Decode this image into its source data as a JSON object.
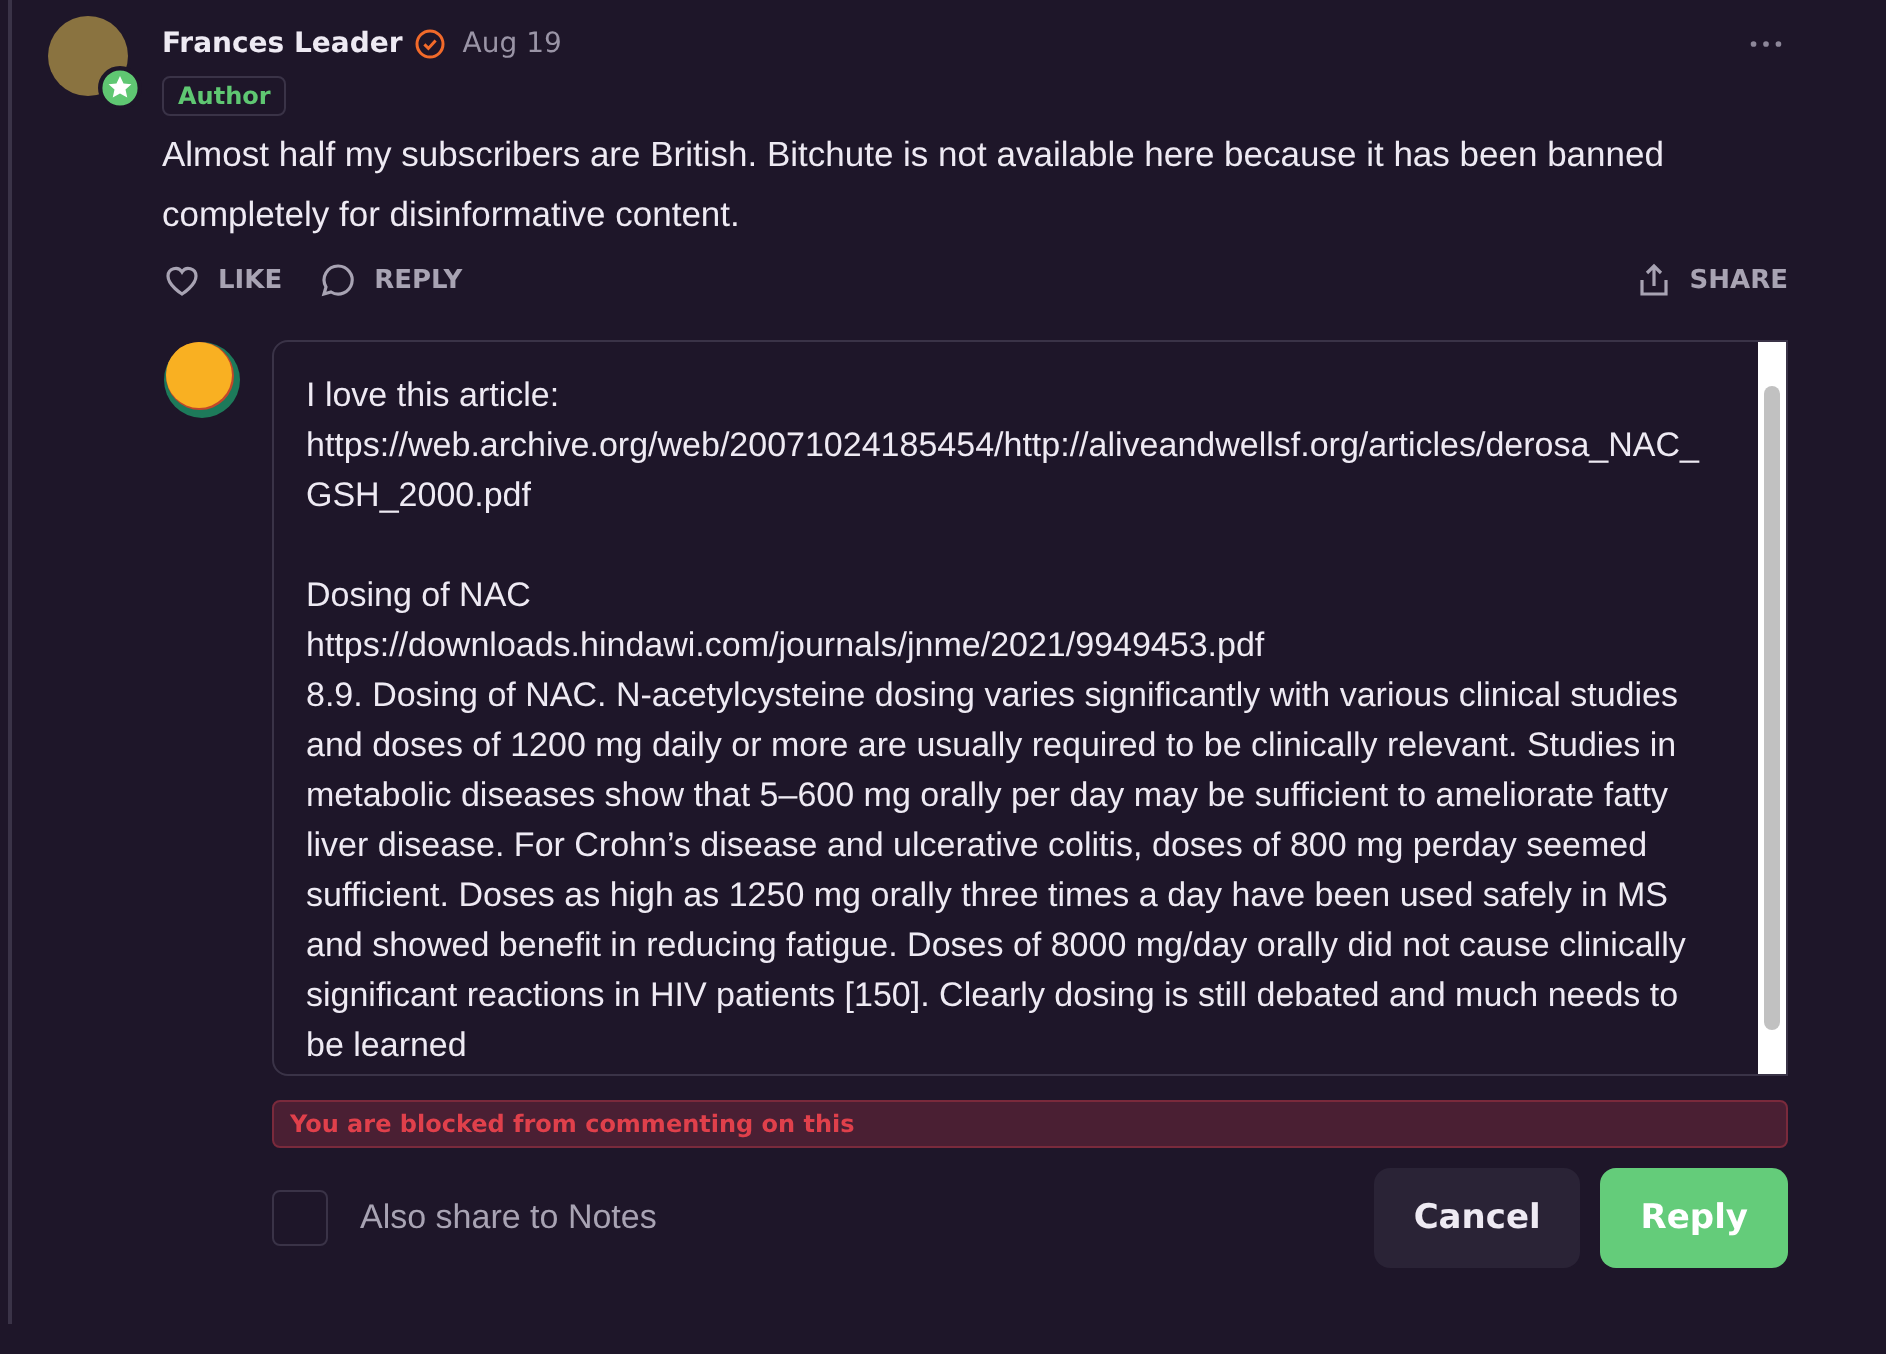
{
  "comment": {
    "author": "Frances Leader",
    "verified": true,
    "date": "Aug 19",
    "badge": "Author",
    "body": "Almost half my subscribers are British. Bitchute is not available here because it has been banned completely for disinformative content.",
    "actions": {
      "like": "LIKE",
      "reply": "REPLY",
      "share": "SHARE"
    }
  },
  "reply_form": {
    "value": "I love this article:\nhttps://web.archive.org/web/20071024185454/http://aliveandwellsf.org/articles/derosa_NAC_GSH_2000.pdf\n\nDosing of NAC\nhttps://downloads.hindawi.com/journals/jnme/2021/9949453.pdf\n8.9. Dosing of NAC. N-acetylcysteine dosing varies significantly with various clinical studies and doses of 1200 mg daily or more are usually required to be clinically relevant. Studies in metabolic diseases show that 5–600 mg orally per day may be sufficient to ameliorate fatty liver disease. For Crohn’s disease and ulcerative colitis, doses of 800 mg perday seemed sufficient. Doses as high as 1250 mg orally three times a day have been used safely in MS and showed benefit in reducing fatigue. Doses of 8000 mg/day orally did not cause clinically significant reactions in HIV patients [150]. Clearly dosing is still debated and much needs to be learned",
    "error": "You are blocked from commenting on this",
    "share_to_notes": {
      "label": "Also share to Notes",
      "checked": false
    },
    "buttons": {
      "cancel": "Cancel",
      "reply": "Reply"
    }
  }
}
